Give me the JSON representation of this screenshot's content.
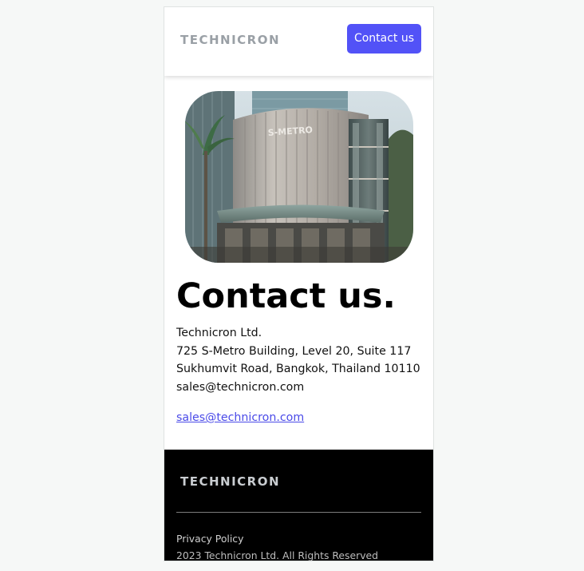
{
  "header": {
    "logo_text": "TECHNICRON",
    "contact_button_label": "Contact us"
  },
  "hero": {
    "image_description_icon": "building-photo",
    "sign_text": "S-METRO"
  },
  "main": {
    "title": "Contact us.",
    "address_lines": [
      "Technicron Ltd.",
      "725 S-Metro Building, Level 20, Suite 117",
      "Sukhumvit Road, Bangkok, Thailand 10110",
      "sales@technicron.com"
    ],
    "email_link": "sales@technicron.com"
  },
  "footer": {
    "logo_text": "TECHNICRON",
    "privacy_link": "Privacy Policy",
    "copyright": "2023 Technicron Ltd. All Rights Reserved"
  },
  "colors": {
    "accent": "#5252f7",
    "link": "#4a4ae8",
    "page_background": "#f6f8f7",
    "footer_background": "#000000"
  }
}
